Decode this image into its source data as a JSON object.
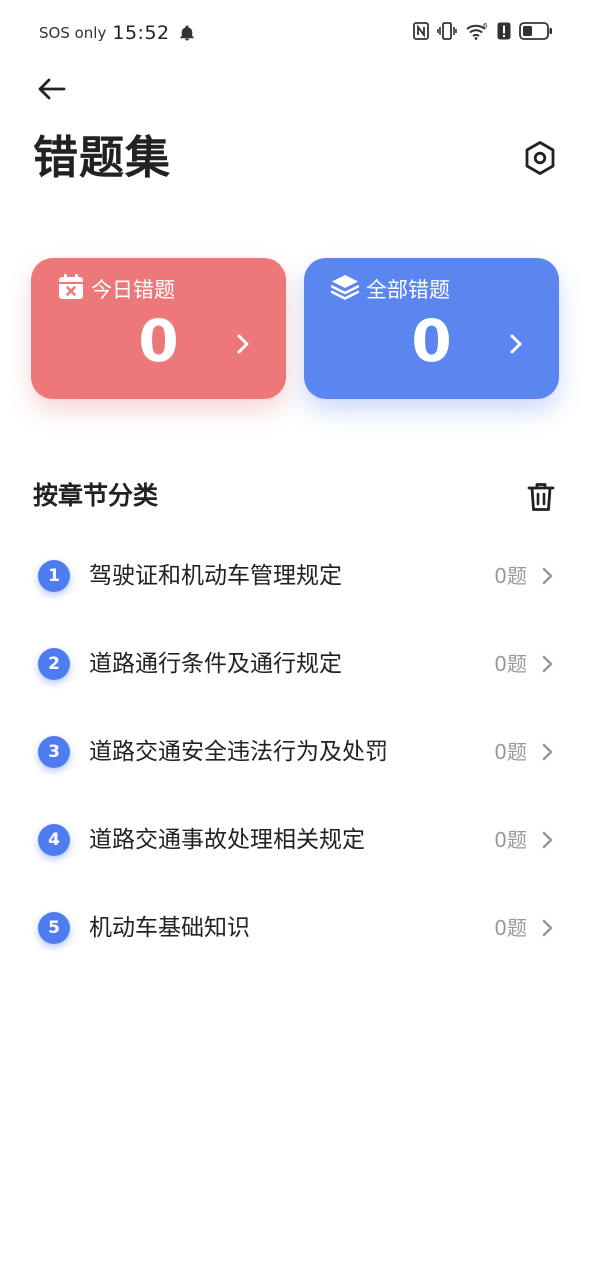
{
  "status_bar": {
    "carrier": "SOS only",
    "time": "15:52",
    "icons": [
      "bell-icon",
      "nfc-icon",
      "vibrate-icon",
      "wifi-icon",
      "alert-icon",
      "battery-icon"
    ]
  },
  "header": {
    "title": "错题集",
    "back_icon": "arrow-left-icon",
    "settings_icon": "gear-hexagon-icon"
  },
  "cards": {
    "today": {
      "label": "今日错题",
      "count": "0",
      "icon": "calendar-x-icon",
      "color": "#ec7879"
    },
    "all": {
      "label": "全部错题",
      "count": "0",
      "icon": "layers-icon",
      "color": "#5b86f0"
    }
  },
  "section": {
    "title": "按章节分类",
    "clear_icon": "trash-icon"
  },
  "chapters": [
    {
      "num": "1",
      "name": "驾驶证和机动车管理规定",
      "count": "0题"
    },
    {
      "num": "2",
      "name": "道路通行条件及通行规定",
      "count": "0题"
    },
    {
      "num": "3",
      "name": "道路交通安全违法行为及处罚",
      "count": "0题"
    },
    {
      "num": "4",
      "name": "道路交通事故处理相关规定",
      "count": "0题"
    },
    {
      "num": "5",
      "name": "机动车基础知识",
      "count": "0题"
    }
  ],
  "colors": {
    "accent": "#4f7cf0",
    "muted_text": "#999999"
  }
}
